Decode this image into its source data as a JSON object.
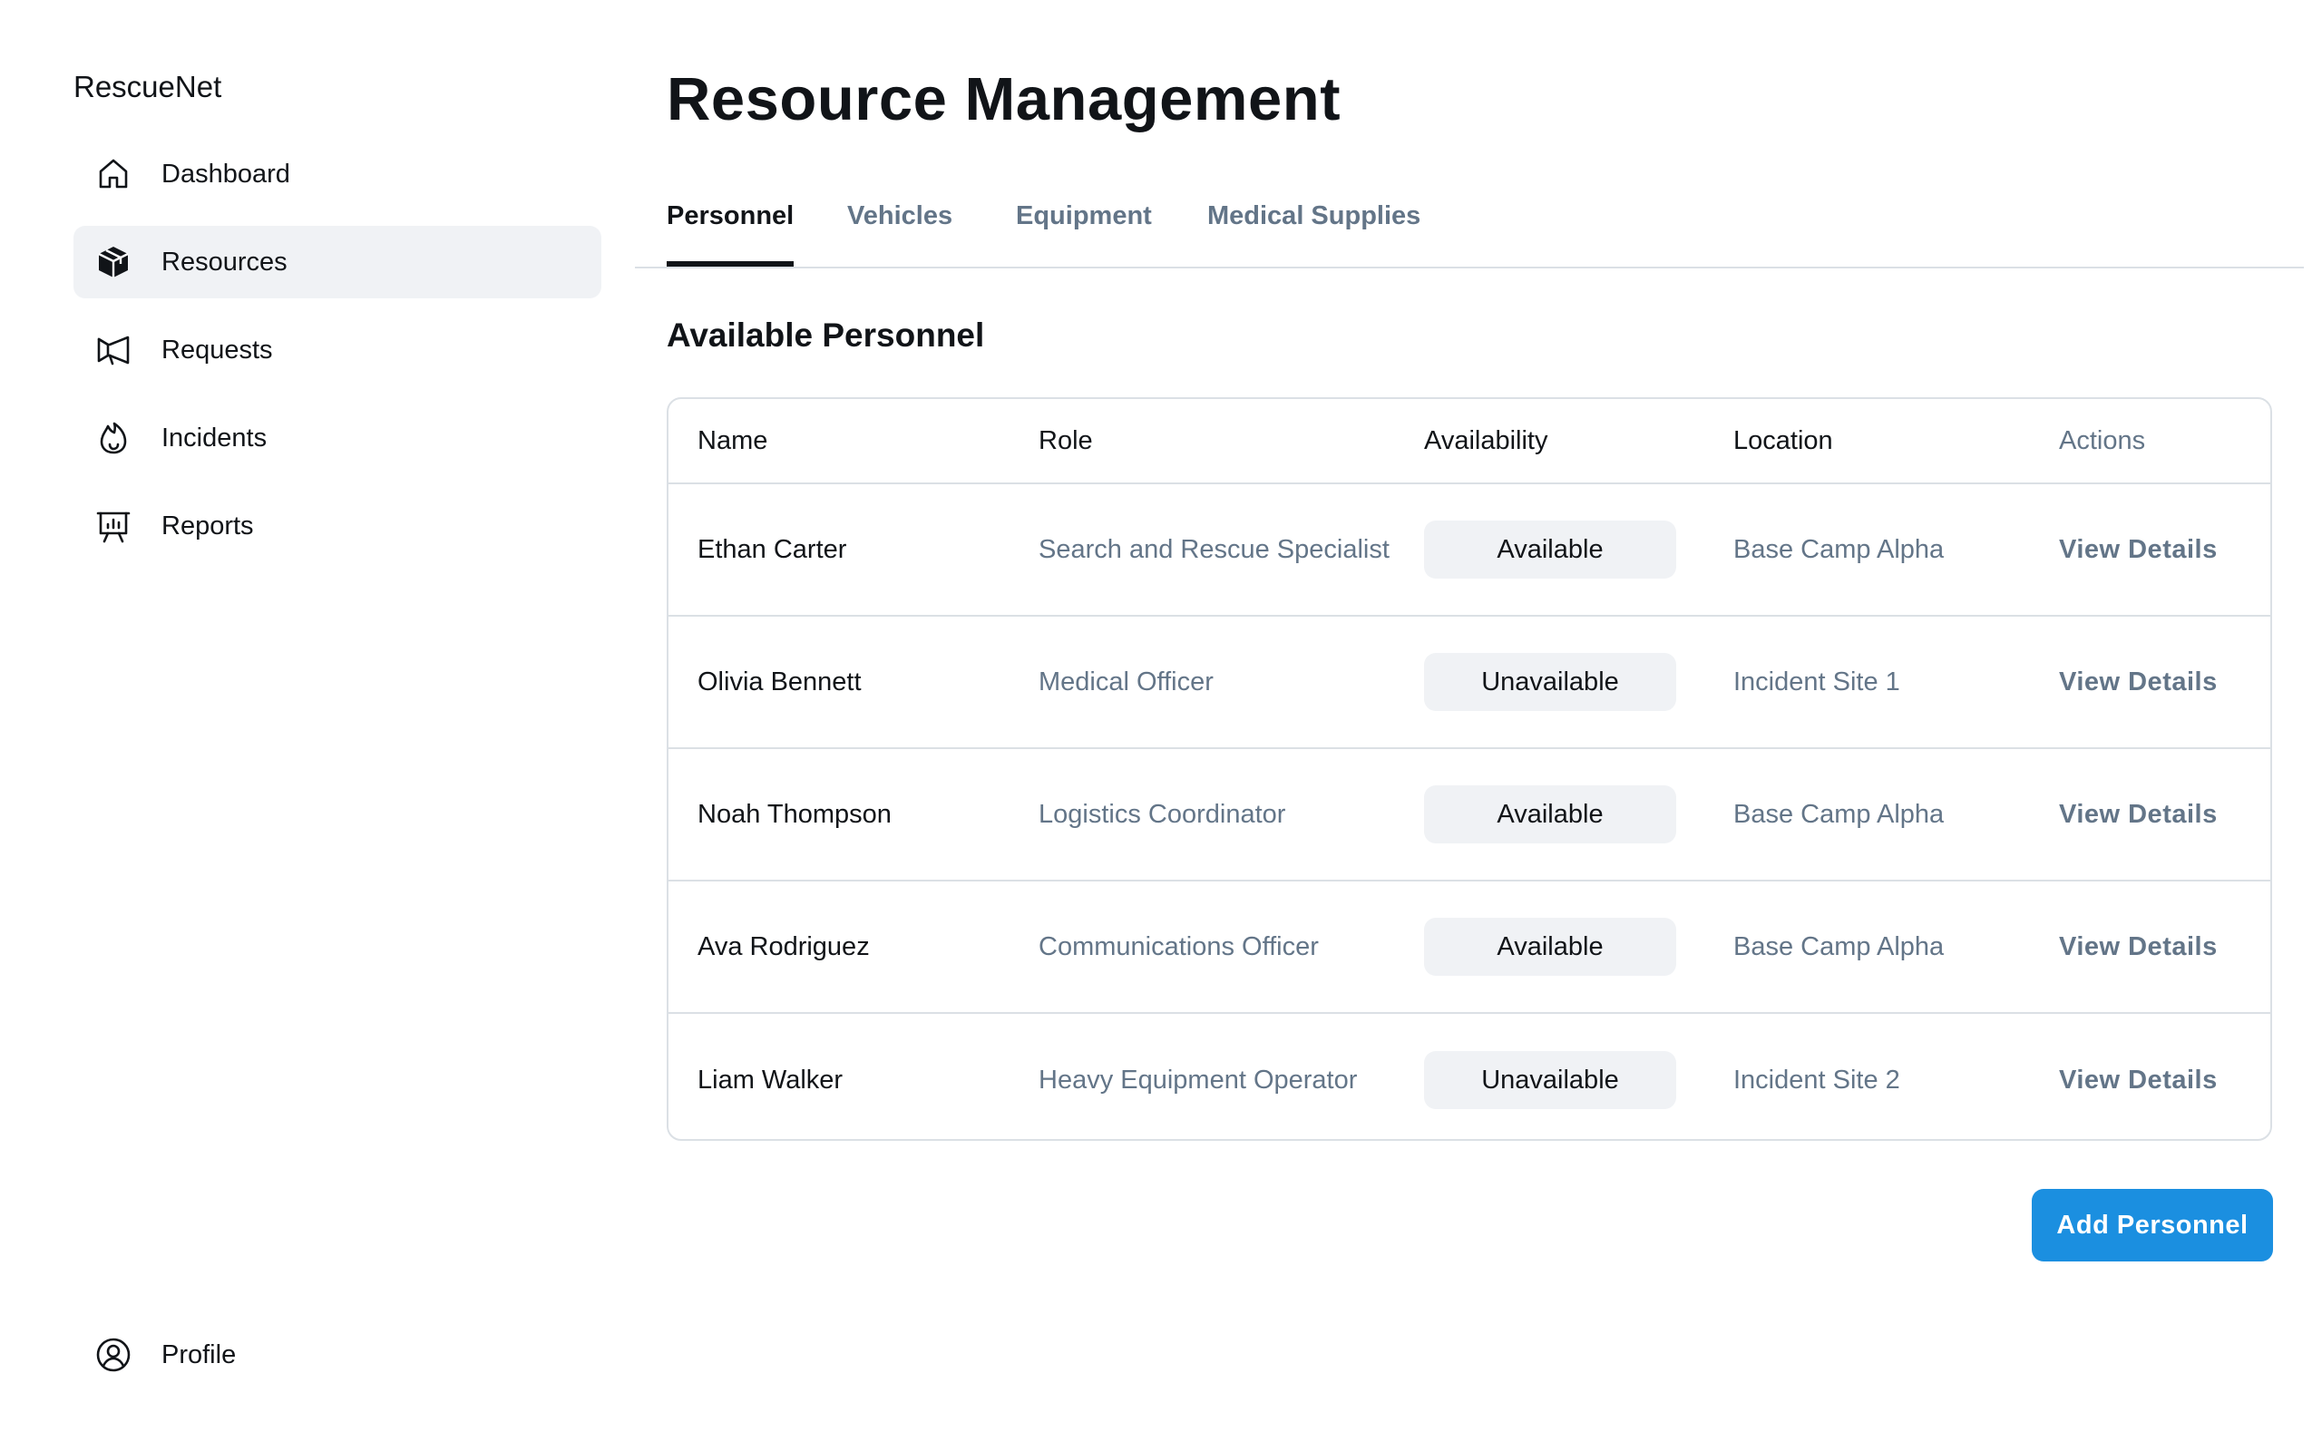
{
  "app": {
    "brand": "RescueNet"
  },
  "sidebar": {
    "items": [
      {
        "label": "Dashboard",
        "icon": "house-icon",
        "active": false
      },
      {
        "label": "Resources",
        "icon": "package-icon",
        "active": true
      },
      {
        "label": "Requests",
        "icon": "megaphone-icon",
        "active": false
      },
      {
        "label": "Incidents",
        "icon": "fire-icon",
        "active": false
      },
      {
        "label": "Reports",
        "icon": "presentation-chart-icon",
        "active": false
      }
    ],
    "profile": {
      "label": "Profile",
      "icon": "user-circle-icon"
    }
  },
  "main": {
    "title": "Resource Management",
    "tabs": [
      {
        "label": "Personnel",
        "active": true
      },
      {
        "label": "Vehicles",
        "active": false
      },
      {
        "label": "Equipment",
        "active": false
      },
      {
        "label": "Medical Supplies",
        "active": false
      }
    ],
    "section_title": "Available Personnel",
    "table": {
      "columns": [
        "Name",
        "Role",
        "Availability",
        "Location",
        "Actions"
      ],
      "rows": [
        {
          "name": "Ethan Carter",
          "role": "Search and Rescue Specialist",
          "availability": "Available",
          "location": "Base Camp Alpha",
          "action": "View Details"
        },
        {
          "name": "Olivia Bennett",
          "role": "Medical Officer",
          "availability": "Unavailable",
          "location": "Incident Site 1",
          "action": "View Details"
        },
        {
          "name": "Noah Thompson",
          "role": "Logistics Coordinator",
          "availability": "Available",
          "location": "Base Camp Alpha",
          "action": "View Details"
        },
        {
          "name": "Ava Rodriguez",
          "role": "Communications Officer",
          "availability": "Available",
          "location": "Base Camp Alpha",
          "action": "View Details"
        },
        {
          "name": "Liam Walker",
          "role": "Heavy Equipment Operator",
          "availability": "Unavailable",
          "location": "Incident Site 2",
          "action": "View Details"
        }
      ]
    },
    "add_button": "Add Personnel"
  },
  "colors": {
    "text_primary": "#111418",
    "text_secondary": "#637588",
    "active_nav_bg": "#f0f2f5",
    "badge_bg": "#f0f2f5",
    "border": "#dbe0e5",
    "accent": "#1b8fe0"
  }
}
